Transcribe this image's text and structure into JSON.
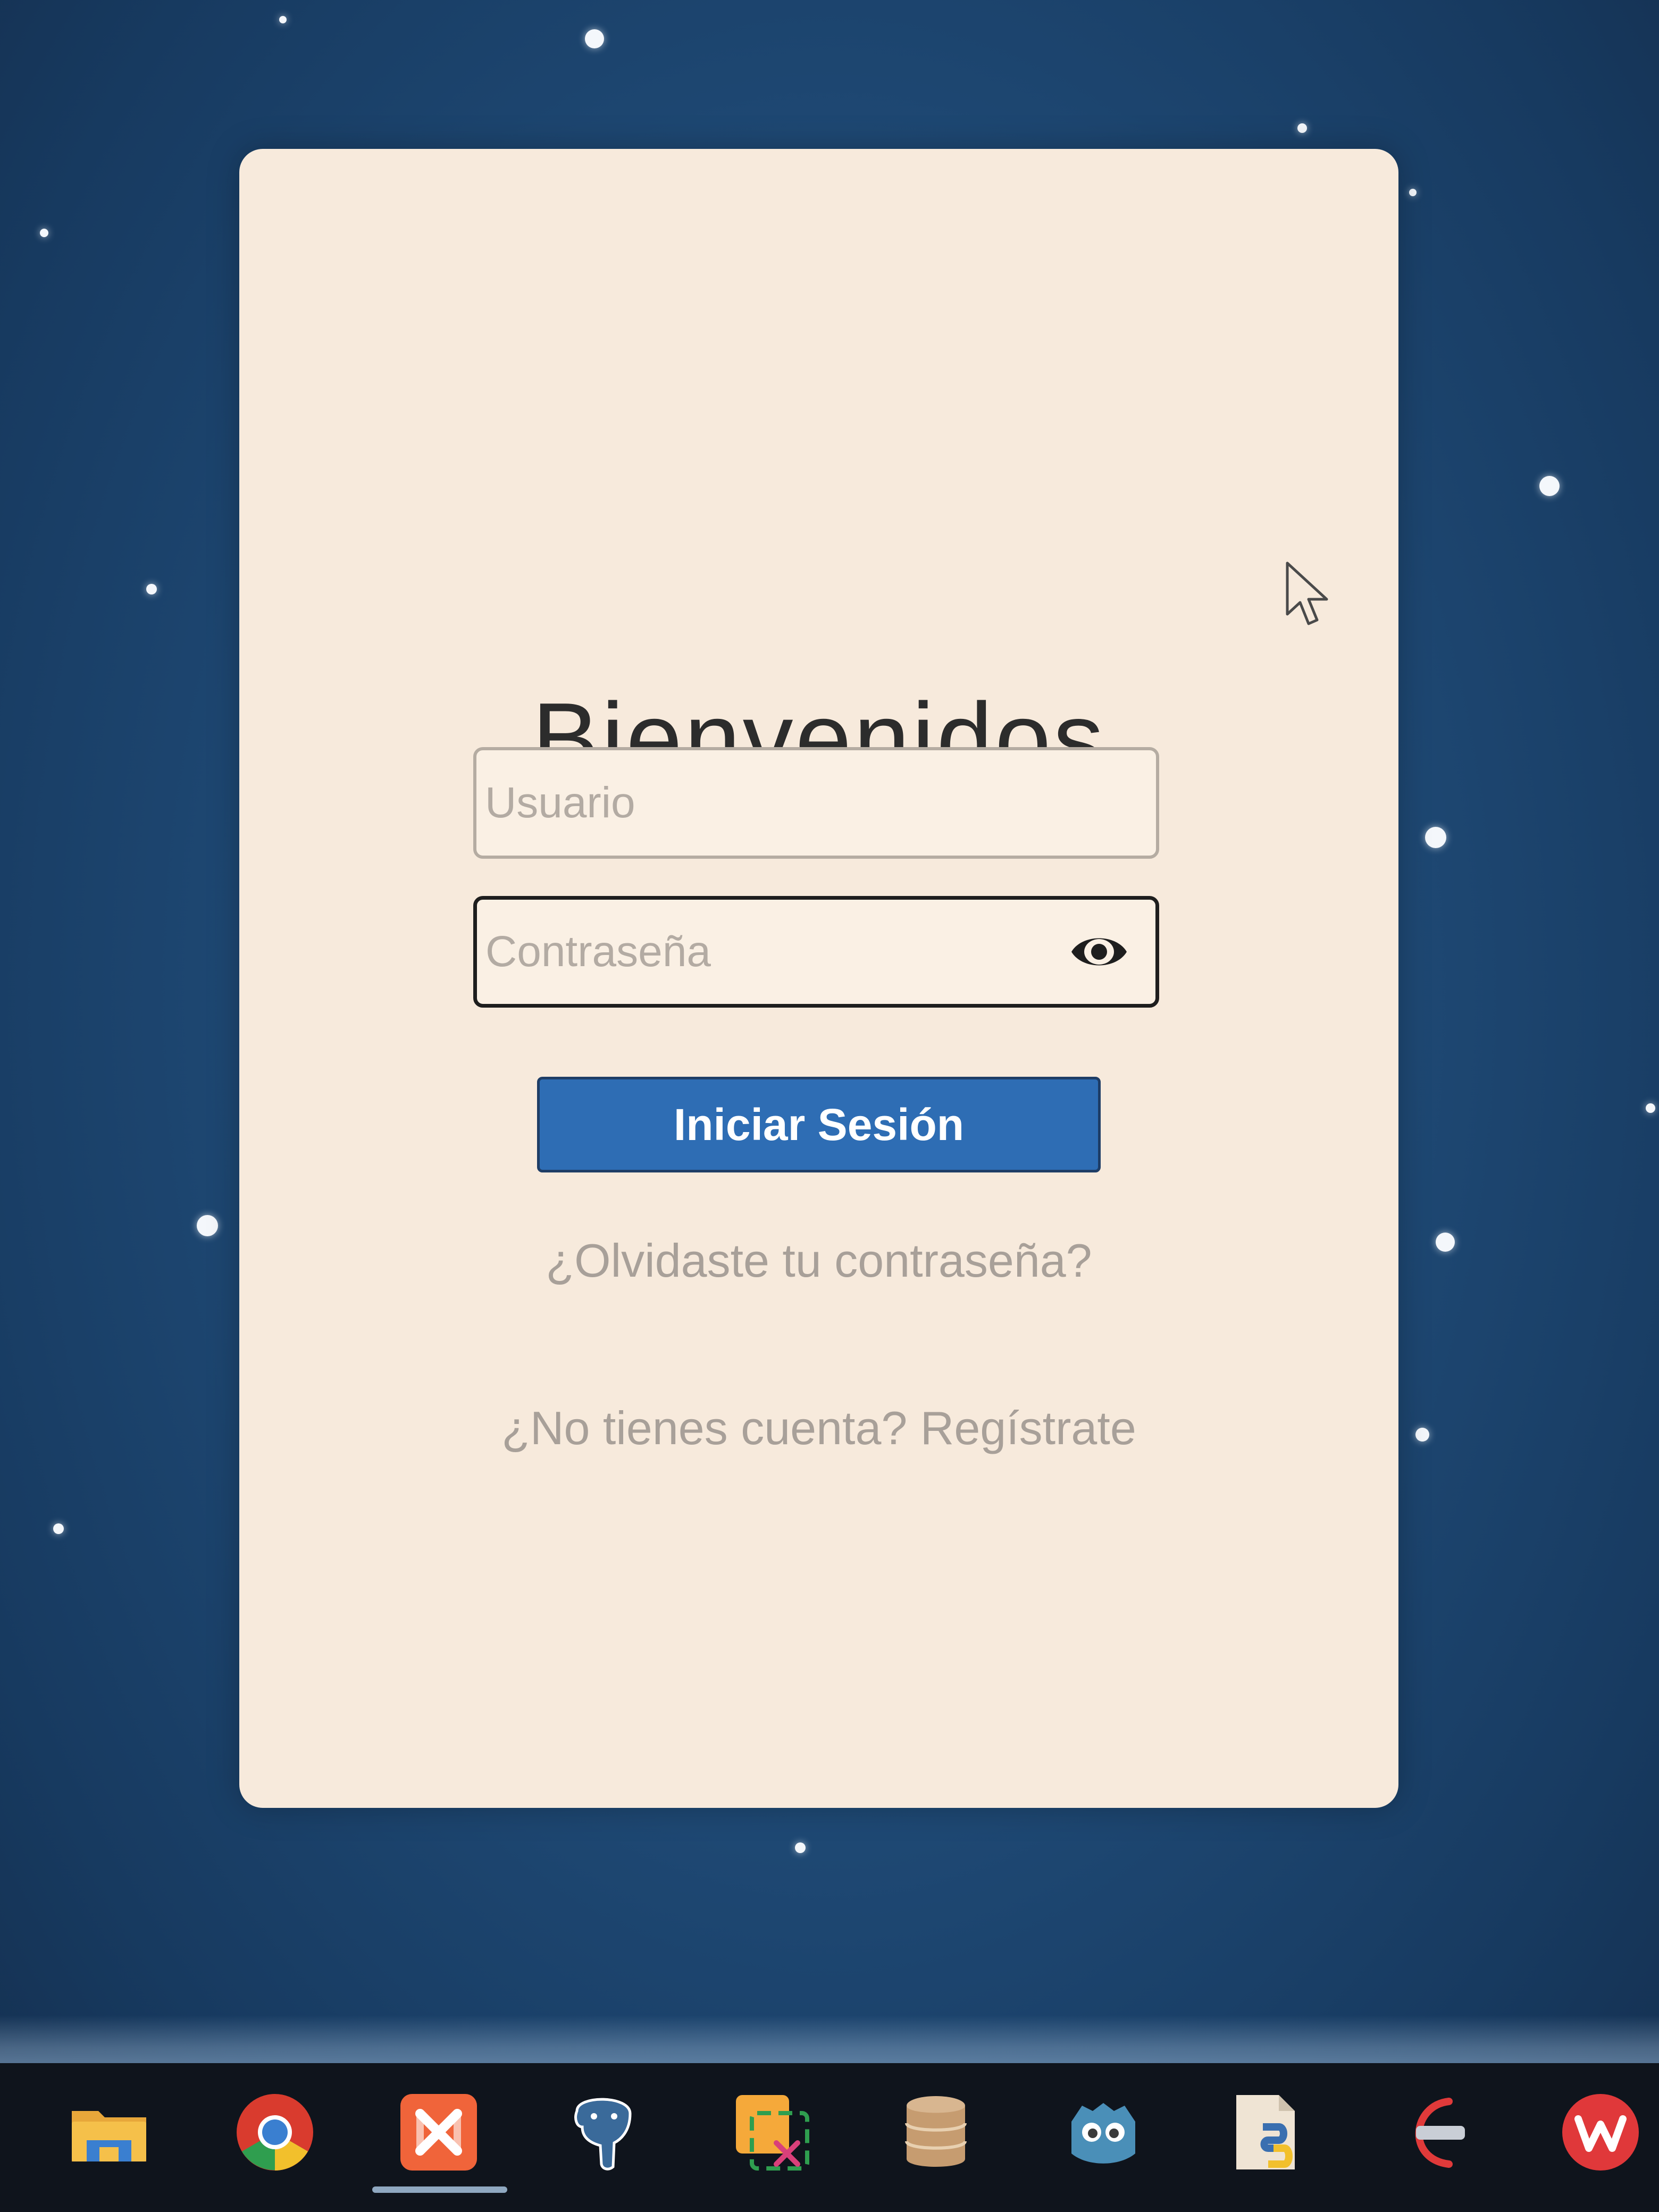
{
  "login": {
    "title": "Bienvenidos",
    "username_placeholder": "Usuario",
    "password_placeholder": "Contraseña",
    "submit_label": "Iniciar Sesión",
    "forgot_password_link": "¿Olvidaste tu contraseña?",
    "register_link": "¿No tienes cuenta? Regístrate"
  },
  "colors": {
    "card_background": "#f7eadc",
    "primary_button": "#2e6db4",
    "desktop_background": "#1f4a76",
    "taskbar_background": "#0f141c"
  },
  "taskbar": {
    "icons": [
      "file-explorer-icon",
      "chrome-icon",
      "xampp-icon",
      "postgresql-icon",
      "snipping-tool-icon",
      "database-icon",
      "godot-icon",
      "python-file-icon",
      "netbeans-icon",
      "wps-office-icon"
    ],
    "active_icon": "xampp-icon"
  }
}
